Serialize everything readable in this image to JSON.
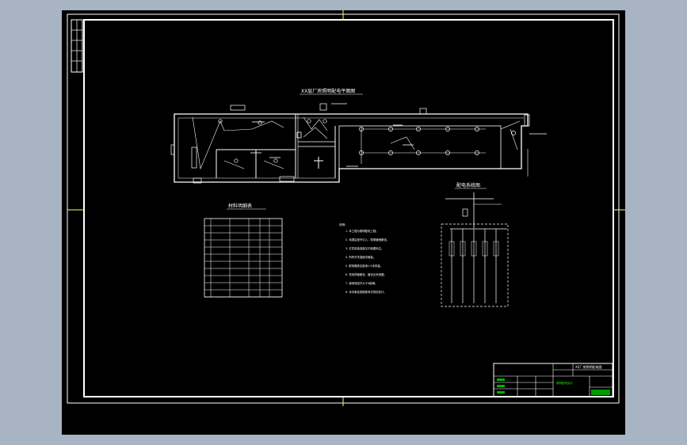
{
  "drawing": {
    "plan_title": "XX层厂房照明配电平面图",
    "table_title": "材料明细表",
    "diagram_title": "配电系统图",
    "notes_heading": "说明：",
    "notes": [
      "1. 本工程为照明配电工程。",
      "2. 电源由室外引入，穿钢管暗敷设。",
      "3. 灯具安装高度见平面图标注。",
      "4. 所有开关插座均暗装。",
      "5. 配电箱底边距地1.5米安装。",
      "6. 导线穿管敷设，管径见系统图。",
      "7. 接地电阻不大于4欧姆。",
      "8. 未尽事宜按国家有关规范执行。"
    ],
    "title_block": {
      "drawing_name": "XX厂房照明配电图",
      "project": "照明配电设计"
    }
  },
  "colors": {
    "background": "#000000",
    "lines": "#ffffff",
    "titleblock_accent": "#00ff00",
    "outer": "#a8b3c3"
  },
  "icons": [
    "lamp-icon",
    "switch-icon",
    "distribution-box-icon"
  ]
}
